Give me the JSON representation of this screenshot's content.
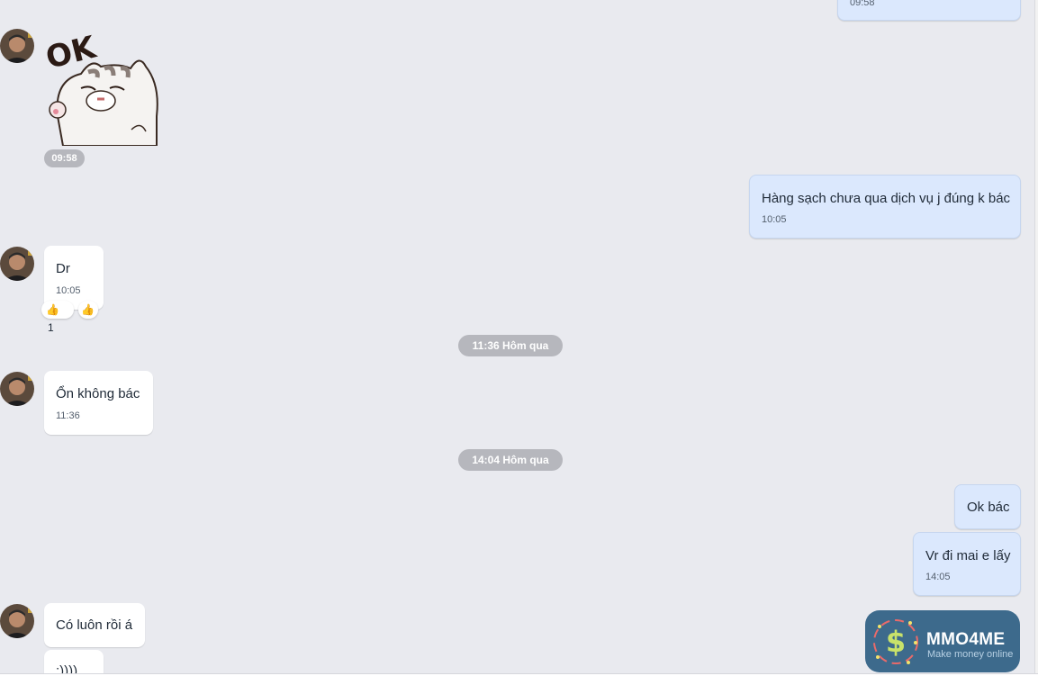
{
  "messages": [
    {
      "id": "m0",
      "direction": "outgoing",
      "time": "09:58"
    },
    {
      "id": "m1",
      "direction": "incoming",
      "type": "sticker",
      "sticker_text": "OK",
      "time": "09:58"
    },
    {
      "id": "m2",
      "direction": "outgoing",
      "text": "Hàng sạch chưa qua dịch vụ j đúng k bác",
      "time": "10:05"
    },
    {
      "id": "m3",
      "direction": "incoming",
      "text": "Dr",
      "time": "10:05",
      "reactions": [
        {
          "emoji": "👍",
          "count": "1"
        },
        {
          "emoji": "👍"
        }
      ]
    },
    {
      "id": "m4",
      "direction": "incoming",
      "text": "Ổn không bác",
      "time": "11:36"
    },
    {
      "id": "m5",
      "direction": "outgoing",
      "text": "Ok bác"
    },
    {
      "id": "m6",
      "direction": "outgoing",
      "text": "Vr đi mai e lấy",
      "time": "14:05"
    },
    {
      "id": "m7",
      "direction": "incoming",
      "text": "Có luôn rồi á"
    },
    {
      "id": "m8",
      "direction": "incoming",
      "text": ":))))"
    }
  ],
  "dividers": [
    "11:36 Hôm qua",
    "14:04 Hôm qua"
  ],
  "watermark": {
    "title": "MMO4ME",
    "subtitle": "Make money online"
  },
  "colors": {
    "background": "#e9eaef",
    "outgoing_bubble": "#dbe8fd",
    "incoming_bubble": "#ffffff",
    "divider": "#b6b7bd",
    "logo": "#3d6a8c"
  },
  "icons": [
    "avatar",
    "ok-cat-sticker",
    "thumbs-up-icon",
    "dollar-icon"
  ]
}
